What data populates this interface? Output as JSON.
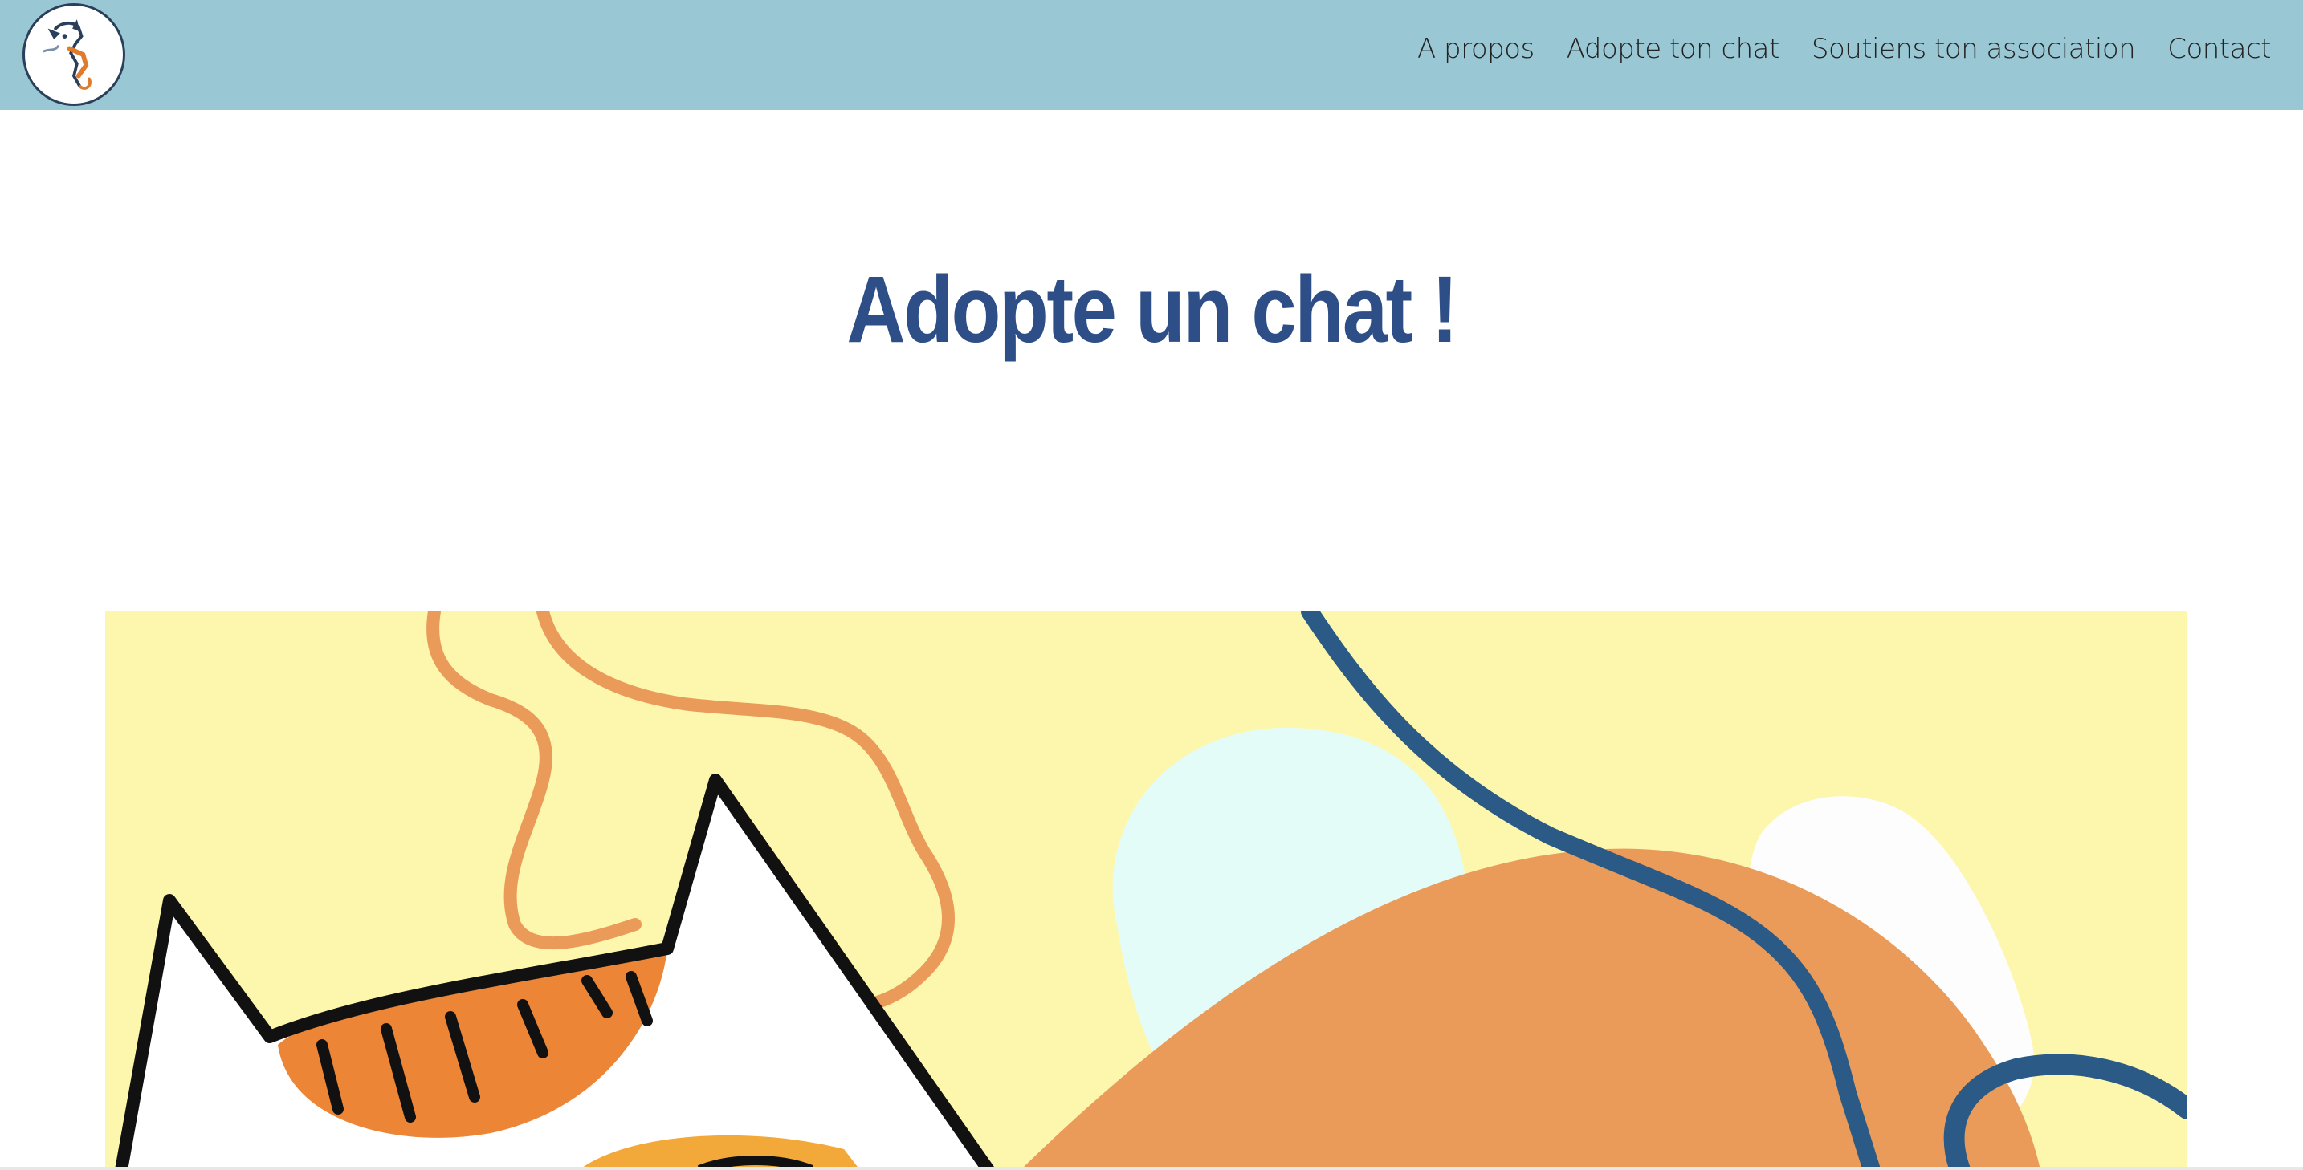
{
  "header": {
    "logo_icon": "cat-logo-icon",
    "background_color": "#9ac7d4"
  },
  "nav": {
    "items": [
      {
        "label": "A propos"
      },
      {
        "label": "Adopte ton chat"
      },
      {
        "label": "Soutiens ton association"
      },
      {
        "label": "Contact"
      }
    ]
  },
  "main": {
    "title": "Adopte un chat !",
    "title_color": "#2d4e86"
  },
  "hero": {
    "image_icon": "cat-illustration",
    "background_color": "#fdf7ae",
    "accent_colors": [
      "#eb9b59",
      "#ed8537",
      "#2a5a85",
      "#e3fcf7"
    ]
  }
}
